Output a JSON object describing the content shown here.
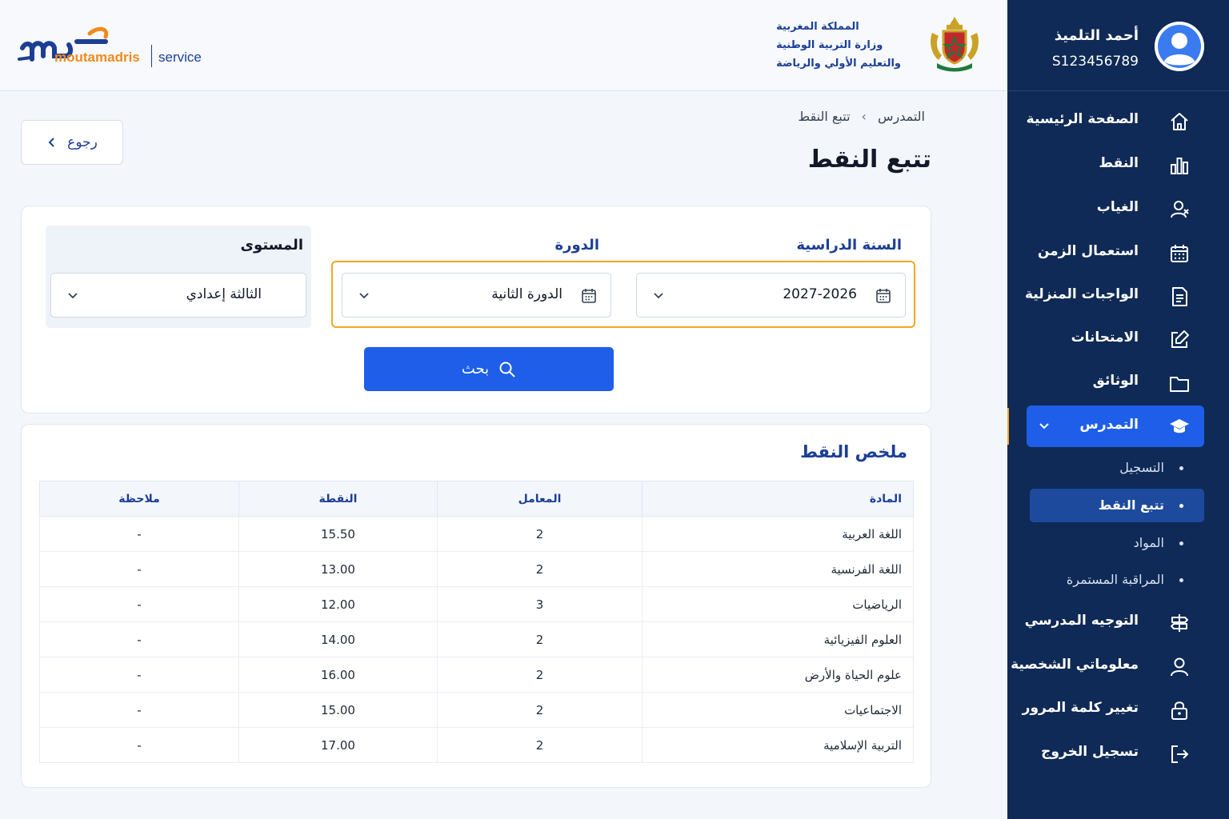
{
  "header": {
    "logo_brand": "moutamadris",
    "logo_service": "service",
    "ministry_line1": "المملكة المغربية",
    "ministry_line2": "وزارة التربية الوطنية",
    "ministry_line3": "والتعليم الأولي والرياضة"
  },
  "profile": {
    "name": "أحمد التلميذ",
    "id": "S123456789"
  },
  "sidebar": {
    "items": [
      {
        "label": "الصفحة الرئيسية",
        "icon": "home-icon"
      },
      {
        "label": "النقط",
        "icon": "bar-chart-icon"
      },
      {
        "label": "الغياب",
        "icon": "user-absence-icon"
      },
      {
        "label": "استعمال الزمن",
        "icon": "calendar-icon"
      },
      {
        "label": "الواجبات المنزلية",
        "icon": "document-icon"
      },
      {
        "label": "الامتحانات",
        "icon": "edit-icon"
      },
      {
        "label": "الوثائق",
        "icon": "folder-icon"
      }
    ],
    "active_item": {
      "label": "التمدرس",
      "icon": "graduation-cap-icon"
    },
    "sub_items": [
      {
        "label": "التسجيل"
      },
      {
        "label": "تتبع النقط"
      },
      {
        "label": "المواد"
      },
      {
        "label": "المراقبة المستمرة"
      }
    ],
    "bottom_items": [
      {
        "label": "التوجيه المدرسي",
        "icon": "signpost-icon"
      },
      {
        "label": "معلوماتي الشخصية",
        "icon": "user-icon"
      },
      {
        "label": "تغيير كلمة المرور",
        "icon": "lock-icon"
      },
      {
        "label": "تسجيل الخروج",
        "icon": "logout-icon"
      }
    ],
    "accent_color": "#f5a623",
    "active_color": "#1e5ee8"
  },
  "main": {
    "breadcrumb": {
      "parent": "التمدرس",
      "current": "تتبع النقط",
      "separator": "›"
    },
    "title": "تتبع النقط",
    "back_label": "رجوع",
    "filters": {
      "year_label": "السنة الدراسية",
      "year_value": "2027-2026",
      "session_label": "الدورة",
      "session_value": "الدورة الثانية",
      "level_label": "المستوى",
      "level_value": "الثالثة إعدادي",
      "search_label": "بحث"
    },
    "summary": {
      "title": "ملخص النقط",
      "columns": [
        "المادة",
        "المعامل",
        "النقطة",
        "ملاحظة"
      ],
      "rows": [
        [
          "اللغة العربية",
          "2",
          "15.50",
          "-"
        ],
        [
          "اللغة الفرنسية",
          "2",
          "13.00",
          "-"
        ],
        [
          "الرياضيات",
          "3",
          "12.00",
          "-"
        ],
        [
          "العلوم الفيزيائية",
          "2",
          "14.00",
          "-"
        ],
        [
          "علوم الحياة والأرض",
          "2",
          "16.00",
          "-"
        ],
        [
          "الاجتماعيات",
          "2",
          "15.00",
          "-"
        ],
        [
          "التربية الإسلامية",
          "2",
          "17.00",
          "-"
        ]
      ]
    }
  }
}
